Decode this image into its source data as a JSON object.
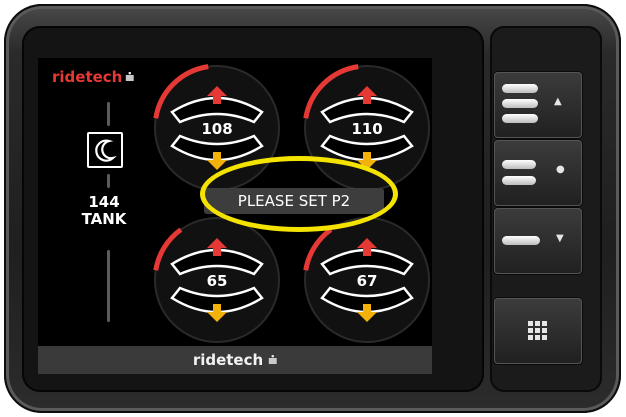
{
  "device": {
    "brand_top": "ridetech",
    "brand_bottom": "ridetech",
    "tank": {
      "value": "144",
      "label": "TANK"
    },
    "gauges": [
      {
        "position": "front-left",
        "value": "108",
        "fill": 0.45
      },
      {
        "position": "front-right",
        "value": "110",
        "fill": 0.45
      },
      {
        "position": "rear-left",
        "value": "65",
        "fill": 0.28
      },
      {
        "position": "rear-right",
        "value": "67",
        "fill": 0.28
      }
    ],
    "message": "PLEASE SET P2"
  },
  "buttons": {
    "up": {
      "indicator": "▲"
    },
    "mid": {
      "indicator": "●"
    },
    "down": {
      "indicator": "▼"
    },
    "menu": {
      "icon": "grid-icon"
    }
  },
  "colors": {
    "accent_red": "#e53935",
    "arrow_up": "#e53935",
    "arrow_down": "#f2b10b",
    "highlight": "#f4e300"
  }
}
